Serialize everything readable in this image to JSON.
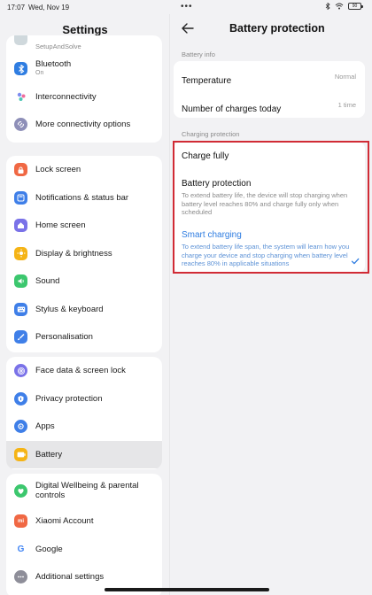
{
  "statusbar": {
    "time": "17:07",
    "date": "Wed, Nov 19",
    "battery": "90"
  },
  "settings": {
    "title": "Settings",
    "groups": [
      {
        "items": [
          {
            "label": "SetupAndSolve",
            "sub": "",
            "icon": "setup-icon",
            "color": "#cfd8dc"
          },
          {
            "label": "Bluetooth",
            "sub": "On",
            "icon": "bluetooth-icon",
            "color": "#2f7de1"
          },
          {
            "label": "Interconnectivity",
            "sub": "",
            "icon": "interconnectivity-icon",
            "color": "#ffffff"
          },
          {
            "label": "More connectivity options",
            "sub": "",
            "icon": "connectivity-icon",
            "color": "#8e8fb8"
          }
        ]
      },
      {
        "items": [
          {
            "label": "Lock screen",
            "icon": "lock-icon",
            "color": "#f06844"
          },
          {
            "label": "Notifications & status bar",
            "icon": "notifications-icon",
            "color": "#3f7fe8"
          },
          {
            "label": "Home screen",
            "icon": "home-icon",
            "color": "#7a72e8"
          },
          {
            "label": "Display & brightness",
            "icon": "brightness-icon",
            "color": "#f5b416"
          },
          {
            "label": "Sound",
            "icon": "sound-icon",
            "color": "#3cc76e"
          },
          {
            "label": "Stylus & keyboard",
            "icon": "keyboard-icon",
            "color": "#3f7fe8"
          },
          {
            "label": "Personalisation",
            "icon": "personalisation-icon",
            "color": "#3f7fe8"
          }
        ]
      },
      {
        "items": [
          {
            "label": "Face data & screen lock",
            "icon": "face-icon",
            "color": "#7a72e8"
          },
          {
            "label": "Privacy protection",
            "icon": "privacy-icon",
            "color": "#3f7fe8"
          },
          {
            "label": "Apps",
            "icon": "apps-icon",
            "color": "#3f7fe8"
          },
          {
            "label": "Battery",
            "icon": "battery-icon",
            "color": "#f5b416"
          }
        ]
      },
      {
        "items": [
          {
            "label": "Digital Wellbeing & parental controls",
            "icon": "wellbeing-icon",
            "color": "#3cc76e"
          },
          {
            "label": "Xiaomi Account",
            "icon": "xiaomi-icon",
            "color": "#f06844"
          },
          {
            "label": "Google",
            "icon": "google-icon",
            "color": "#ffffff"
          },
          {
            "label": "Additional settings",
            "icon": "additional-settings-icon",
            "color": "#8e8e99"
          }
        ]
      }
    ]
  },
  "battery_protection": {
    "title": "Battery protection",
    "battery_info_label": "Battery info",
    "temperature_label": "Temperature",
    "temperature_value": "Normal",
    "charges_label": "Number of charges today",
    "charges_value": "1 time",
    "charging_protection_label": "Charging protection",
    "options": [
      {
        "title": "Charge fully",
        "desc": ""
      },
      {
        "title": "Battery protection",
        "desc": "To extend battery life, the device will stop charging when battery level reaches 80% and charge fully only when scheduled"
      },
      {
        "title": "Smart charging",
        "desc": "To extend battery life span, the system will learn how you charge your device and stop charging when battery level reaches 80% in applicable situations"
      }
    ],
    "selected_option": "Smart charging",
    "accent_color": "#2f7de1"
  }
}
